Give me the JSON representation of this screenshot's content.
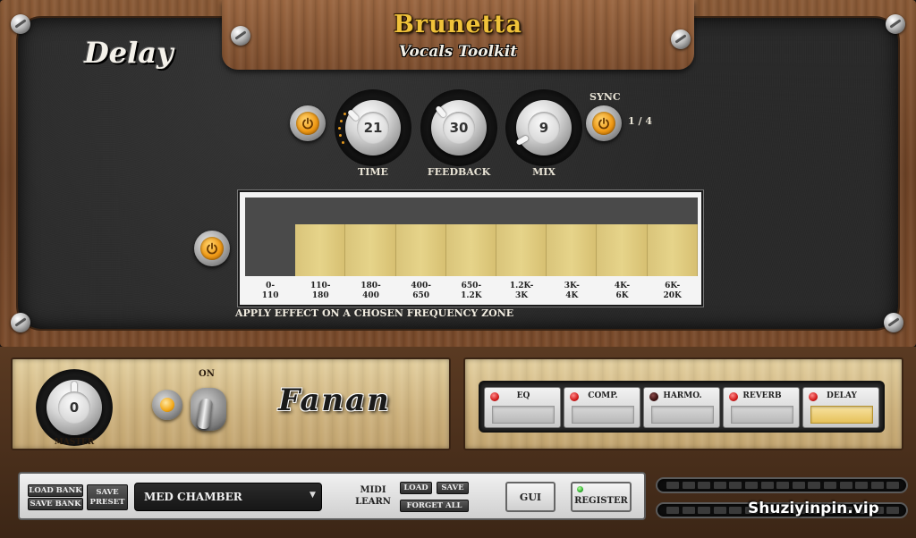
{
  "header": {
    "brand": "Brunetta",
    "subtitle": "Vocals Toolkit",
    "module_title": "Delay"
  },
  "delay": {
    "power_on": true,
    "knobs": [
      {
        "label": "TIME",
        "value": "21"
      },
      {
        "label": "FEEDBACK",
        "value": "30"
      },
      {
        "label": "MIX",
        "value": "9"
      }
    ],
    "sync_label": "SYNC",
    "sync_value": "1 / 4"
  },
  "frequency": {
    "caption": "APPLY EFFECT ON A CHOSEN FREQUENCY ZONE",
    "bands": [
      {
        "line1": "0-",
        "line2": "110",
        "active": false
      },
      {
        "line1": "110-",
        "line2": "180",
        "active": true
      },
      {
        "line1": "180-",
        "line2": "400",
        "active": true
      },
      {
        "line1": "400-",
        "line2": "650",
        "active": true
      },
      {
        "line1": "650-",
        "line2": "1.2K",
        "active": true
      },
      {
        "line1": "1.2K-",
        "line2": "3K",
        "active": true
      },
      {
        "line1": "3K-",
        "line2": "4K",
        "active": true
      },
      {
        "line1": "4K-",
        "line2": "6K",
        "active": true
      },
      {
        "line1": "6K-",
        "line2": "20K",
        "active": true
      }
    ]
  },
  "master": {
    "label": "MASTER",
    "value": "0",
    "on_label": "ON",
    "logo": "Fanan"
  },
  "fx_chain": [
    {
      "label": "EQ",
      "led_on": true,
      "active": false
    },
    {
      "label": "COMP.",
      "led_on": true,
      "active": false
    },
    {
      "label": "HARMO.",
      "led_on": false,
      "active": false
    },
    {
      "label": "REVERB",
      "led_on": true,
      "active": false
    },
    {
      "label": "DELAY",
      "led_on": true,
      "active": true
    }
  ],
  "bottom": {
    "load_bank": "LOAD BANK",
    "save_bank": "SAVE BANK",
    "save_preset_line1": "SAVE",
    "save_preset_line2": "PRESET",
    "preset_name": "MED CHAMBER",
    "midi_learn_line1": "MIDI",
    "midi_learn_line2": "LEARN",
    "load": "LOAD",
    "save": "SAVE",
    "forget_all": "FORGET ALL",
    "gui": "GUI",
    "register": "REGISTER"
  },
  "watermark": "Shuziyinpin.vip",
  "colors": {
    "accent_orange": "#f09a16",
    "band_active": "#e0cc82",
    "band_inactive": "#4a4a4a",
    "led_red": "#d11a1a",
    "led_green": "#2fb12f"
  }
}
